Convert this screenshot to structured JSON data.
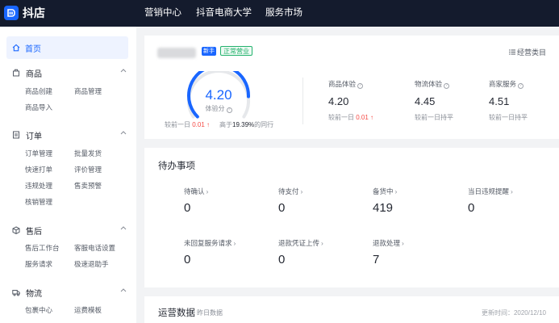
{
  "app": {
    "logo_text": "抖店"
  },
  "topnav": [
    {
      "label": "营销中心"
    },
    {
      "label": "抖音电商大学"
    },
    {
      "label": "服务市场"
    }
  ],
  "sidebar": {
    "home": "首页",
    "groups": [
      {
        "title": "商品",
        "icon": "box-icon",
        "items": [
          "商品创建",
          "商品管理",
          "商品导入"
        ]
      },
      {
        "title": "订单",
        "icon": "order-icon",
        "items": [
          "订单管理",
          "批量发货",
          "快速打单",
          "评价管理",
          "违规处理",
          "售卖预警",
          "核销管理"
        ]
      },
      {
        "title": "售后",
        "icon": "cube-icon",
        "items": [
          "售后工作台",
          "客服电话设置",
          "服务请求",
          "极速退助手"
        ]
      },
      {
        "title": "物流",
        "icon": "truck-icon",
        "items": [
          "包裹中心",
          "运费模板"
        ]
      }
    ]
  },
  "shop": {
    "badge_new": "新手",
    "status": "正常营业",
    "manage_label": "经营类目"
  },
  "score": {
    "value": "4.20",
    "fraction": 0.84,
    "label": "体验分",
    "compare_prefix": "较前一日",
    "compare_value": "0.01",
    "peer_prefix": "高于",
    "peer_value": "19.39%",
    "peer_suffix": "的同行"
  },
  "metrics": [
    {
      "title": "商品体验",
      "value": "4.20",
      "sub_prefix": "较前一日",
      "sub_value": "0.01",
      "trend": "up"
    },
    {
      "title": "物流体验",
      "value": "4.45",
      "sub_prefix": "较前一日持平",
      "sub_value": "",
      "trend": "flat"
    },
    {
      "title": "商家服务",
      "value": "4.51",
      "sub_prefix": "较前一日持平",
      "sub_value": "",
      "trend": "flat"
    }
  ],
  "todo": {
    "title": "待办事项",
    "items": [
      {
        "label": "待确认",
        "value": "0"
      },
      {
        "label": "待支付",
        "value": "0"
      },
      {
        "label": "备货中",
        "value": "419"
      },
      {
        "label": "当日违规提醒",
        "value": "0",
        "highlight": "#f54a45"
      },
      {
        "label": "未回复服务请求",
        "value": "0"
      },
      {
        "label": "退款凭证上传",
        "value": "0"
      },
      {
        "label": "退款处理",
        "value": "7"
      }
    ]
  },
  "ops": {
    "title": "运营数据",
    "subtitle": "昨日数据",
    "updated": "更新时间：2020/12/10"
  },
  "colors": {
    "accent": "#1966ff",
    "topbar": "#141b2d",
    "success": "#23b26d",
    "danger": "#f54a45"
  }
}
